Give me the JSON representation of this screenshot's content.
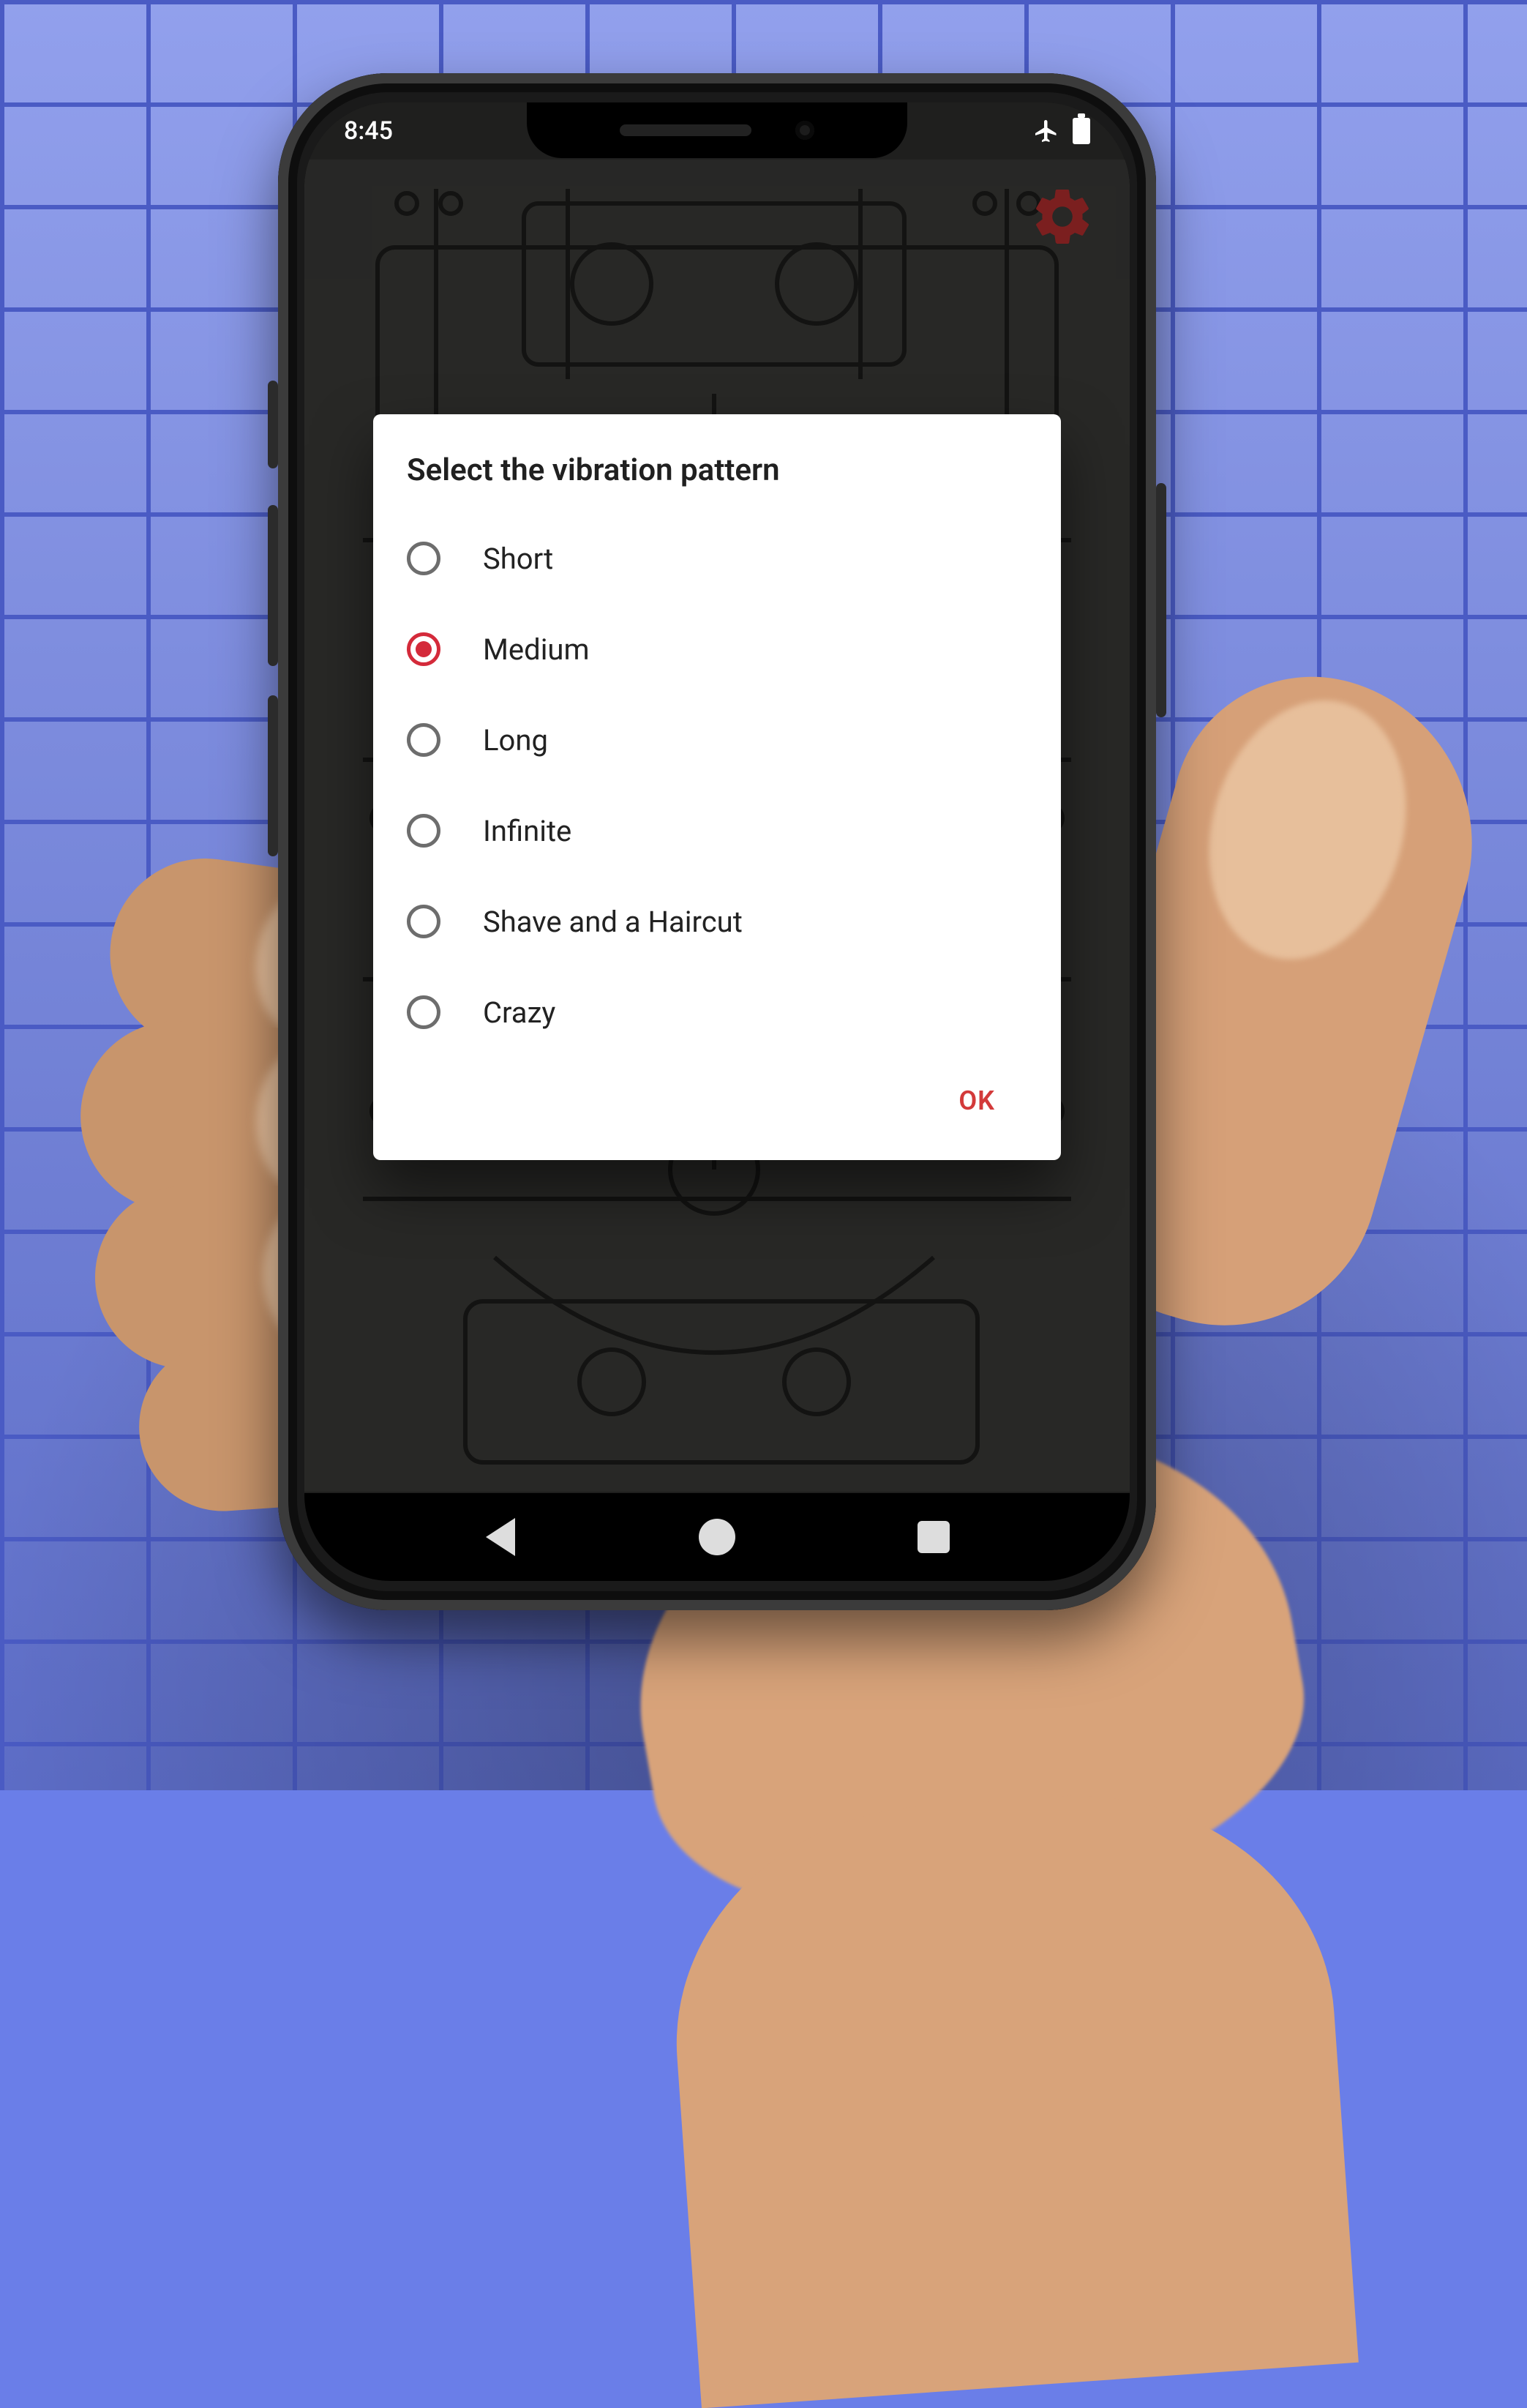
{
  "status_bar": {
    "time": "8:45",
    "airplane_mode": true,
    "battery_full": true
  },
  "settings_icon": "gear-icon",
  "dialog": {
    "title": "Select the vibration pattern",
    "options": [
      {
        "label": "Short",
        "selected": false
      },
      {
        "label": "Medium",
        "selected": true
      },
      {
        "label": "Long",
        "selected": false
      },
      {
        "label": "Infinite",
        "selected": false
      },
      {
        "label": "Shave and a Haircut",
        "selected": false
      },
      {
        "label": "Crazy",
        "selected": false
      }
    ],
    "ok_label": "OK"
  },
  "nav_bar": {
    "back": "back-triangle",
    "home": "home-circle",
    "recent": "recent-square"
  },
  "colors": {
    "accent": "#d33a3a",
    "gear": "#7b1f1f",
    "dialog_bg": "#ffffff"
  }
}
